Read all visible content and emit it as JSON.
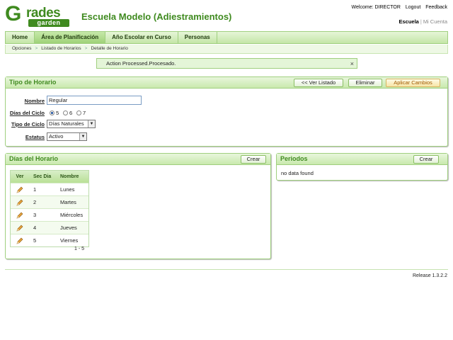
{
  "logo": {
    "letter": "G",
    "rest": "rades",
    "sub": "garden"
  },
  "school_title": "Escuela Modelo (Adiestramientos)",
  "top_links": {
    "welcome": "Welcome: DIRECTOR",
    "logout": "Logout",
    "feedback": "Feedback"
  },
  "user_links": {
    "escuela": "Escuela",
    "mi_cuenta": "Mi Cuenta"
  },
  "nav": {
    "tabs": [
      "Home",
      "Área de Planificación",
      "Año Escolar en Curso",
      "Personas"
    ],
    "active": "Área de Planificación"
  },
  "breadcrumb": [
    "Opciones",
    "Listado de Horarios",
    "Detalle de Horario"
  ],
  "message": {
    "text": "Action Processed.Procesado.",
    "close": "×"
  },
  "tipo_horario": {
    "title": "Tipo de Horario",
    "buttons": {
      "back": "<< Ver Listado",
      "delete": "Eliminar",
      "apply": "Aplicar Cambios"
    },
    "nombre": {
      "label": "Nombre",
      "value": "Regular"
    },
    "dias_ciclo": {
      "label": "Días del Ciclo",
      "options": [
        "5",
        "6",
        "7"
      ],
      "selected": "5"
    },
    "tipo_ciclo": {
      "label": "Tipo de Ciclo",
      "value": "Días Naturales"
    },
    "estatus": {
      "label": "Estatus",
      "value": "Activo"
    }
  },
  "dias_horario": {
    "title": "Días del Horario",
    "create": "Crear",
    "headers": [
      "Ver",
      "Sec Dia",
      "Nombre"
    ],
    "rows": [
      {
        "sec": "1",
        "nombre": "Lunes"
      },
      {
        "sec": "2",
        "nombre": "Martes"
      },
      {
        "sec": "3",
        "nombre": "Miércoles"
      },
      {
        "sec": "4",
        "nombre": "Jueves"
      },
      {
        "sec": "5",
        "nombre": "Viernes"
      }
    ],
    "pagination": "1 - 5",
    "row_icon": "pencil-icon"
  },
  "periodos": {
    "title": "Periodos",
    "create": "Crear",
    "empty": "no data found"
  },
  "release": "Release 1.3.2.2",
  "colors": {
    "brand_green": "#3f8a1f",
    "border_green": "#9fcf7e",
    "apply_text": "#a05a00"
  }
}
